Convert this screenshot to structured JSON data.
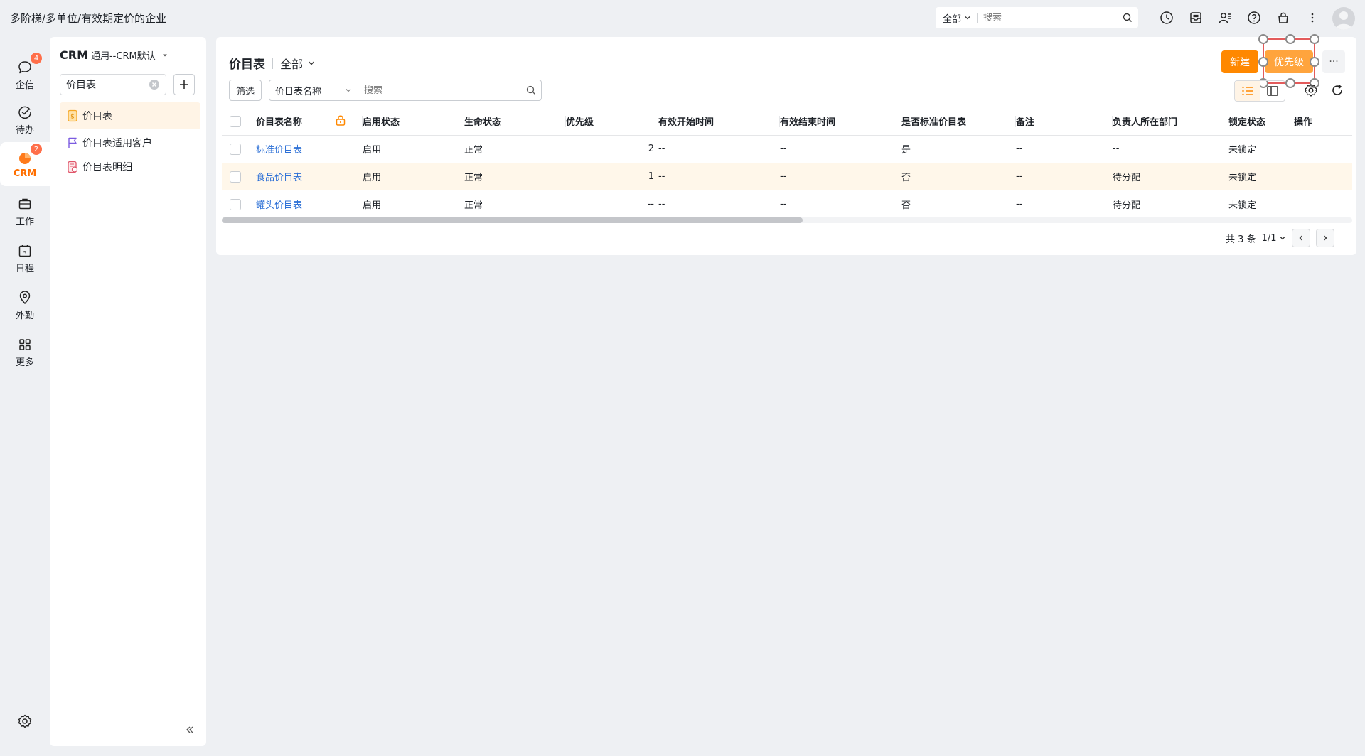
{
  "company": "多阶梯/多单位/有效期定价的企业",
  "global_search": {
    "scope": "全部",
    "placeholder": "搜索"
  },
  "topbar_icons": [
    "clock-icon",
    "inbox-icon",
    "contacts-icon",
    "help-icon",
    "bag-icon",
    "more-vertical-icon"
  ],
  "nav": [
    {
      "label": "企信",
      "icon": "chat-icon",
      "badge": "4"
    },
    {
      "label": "待办",
      "icon": "check-circle-icon",
      "badge": ""
    },
    {
      "label": "CRM",
      "icon": "crm-icon",
      "badge": "2",
      "active": true
    },
    {
      "label": "工作",
      "icon": "briefcase-icon",
      "badge": ""
    },
    {
      "label": "日程",
      "icon": "calendar-icon",
      "badge": ""
    },
    {
      "label": "外勤",
      "icon": "location-icon",
      "badge": ""
    },
    {
      "label": "更多",
      "icon": "grid-icon",
      "badge": ""
    }
  ],
  "sidebar": {
    "title": "CRM",
    "view": "通用--CRM默认",
    "search_value": "价目表",
    "items": [
      {
        "label": "价目表",
        "icon": "pricelist-icon",
        "selected": true
      },
      {
        "label": "价目表适用客户",
        "icon": "flag-icon",
        "selected": false
      },
      {
        "label": "价目表明细",
        "icon": "pricelist-detail-icon",
        "selected": false
      }
    ]
  },
  "main": {
    "title": "价目表",
    "view_selector": "全部",
    "new_button": "新建",
    "priority_button": "优先级",
    "more_button": "···",
    "filter_button": "筛选",
    "search_field": "价目表名称",
    "search_placeholder": "搜索"
  },
  "table": {
    "columns": [
      "价目表名称",
      "启用状态",
      "生命状态",
      "优先级",
      "有效开始时间",
      "有效结束时间",
      "是否标准价目表",
      "备注",
      "负责人所在部门",
      "锁定状态",
      "操作"
    ],
    "rows": [
      [
        "标准价目表",
        "启用",
        "正常",
        "2",
        "--",
        "--",
        "是",
        "--",
        "--",
        "未锁定",
        ""
      ],
      [
        "食品价目表",
        "启用",
        "正常",
        "1",
        "--",
        "--",
        "否",
        "--",
        "待分配",
        "未锁定",
        ""
      ],
      [
        "罐头价目表",
        "启用",
        "正常",
        "--",
        "--",
        "--",
        "否",
        "--",
        "待分配",
        "未锁定",
        ""
      ]
    ],
    "highlighted_row": 1
  },
  "pager": {
    "total": "共 3 条",
    "page": "1/1"
  },
  "colors": {
    "accent": "#ff8800",
    "link": "#2b6fd6",
    "highlight": "#fff7ea"
  }
}
